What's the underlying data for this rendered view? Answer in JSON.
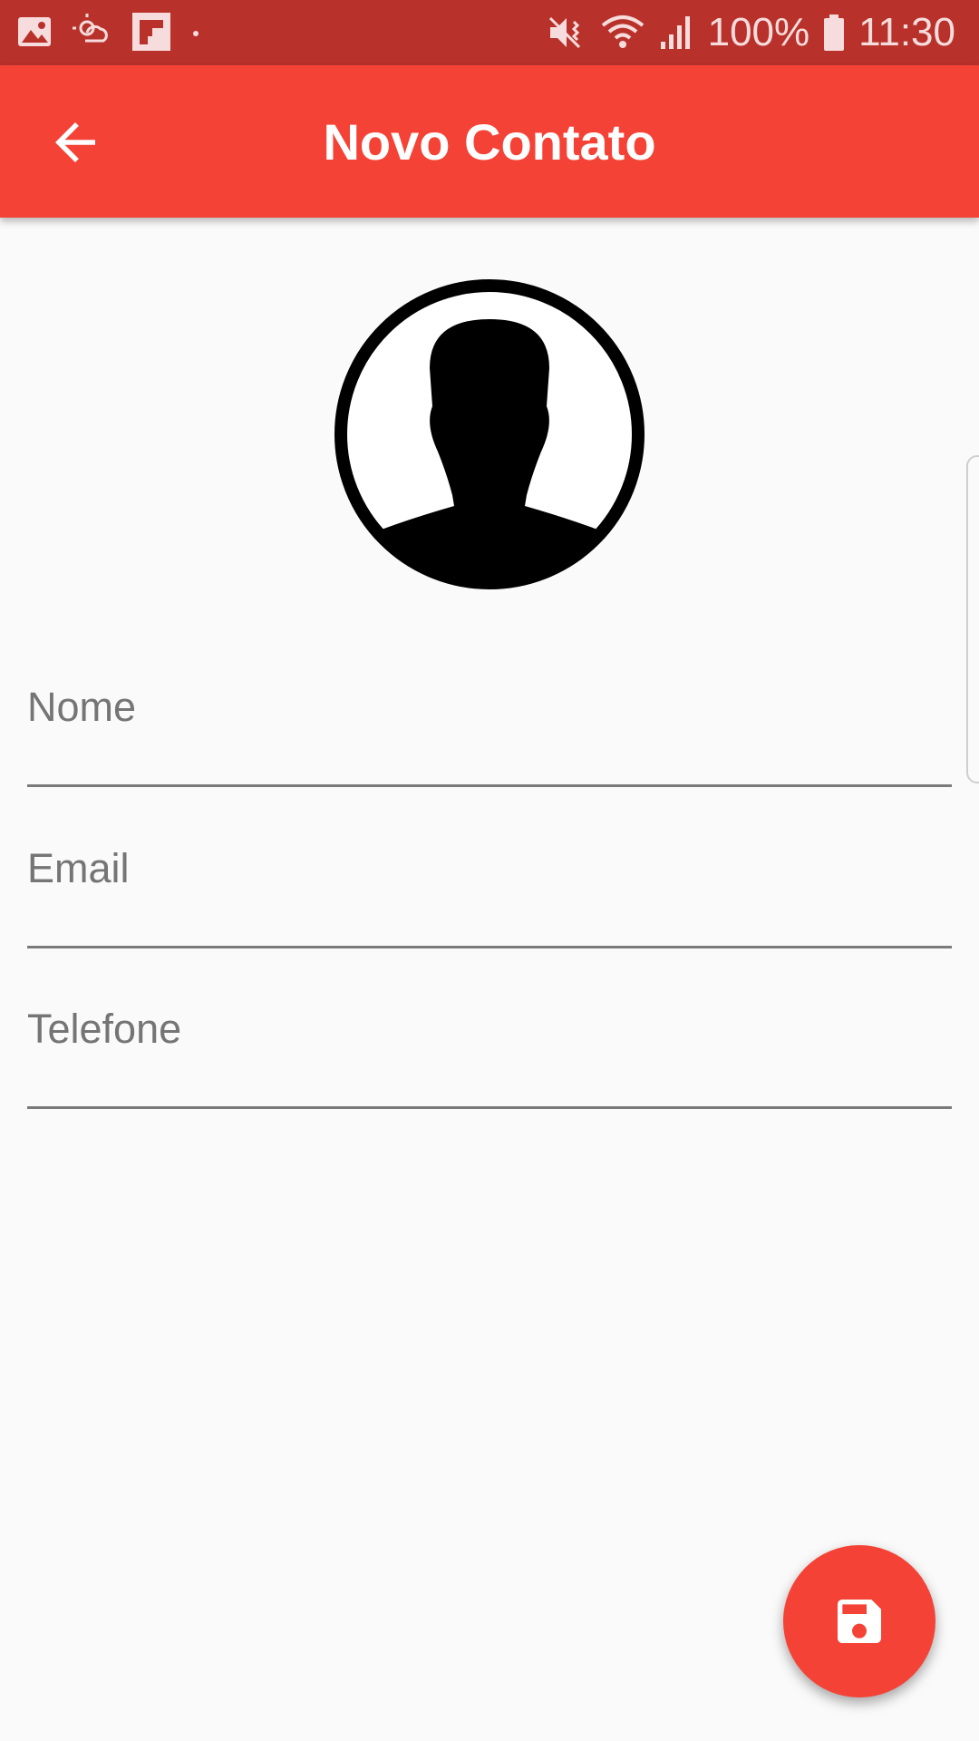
{
  "status_bar": {
    "battery": "100%",
    "time": "11:30",
    "icons": [
      "gallery-icon",
      "weather-icon",
      "flipboard-icon",
      "dot-icon",
      "mute-icon",
      "wifi-icon",
      "signal-icon",
      "battery-icon"
    ]
  },
  "app_bar": {
    "title": "Novo Contato",
    "back_icon": "arrow-back-icon",
    "color": "#f44336",
    "status_color": "#b8322b"
  },
  "avatar": {
    "icon": "person-silhouette-icon"
  },
  "form": {
    "fields": [
      {
        "label": "Nome",
        "value": ""
      },
      {
        "label": "Email",
        "value": ""
      },
      {
        "label": "Telefone",
        "value": ""
      }
    ]
  },
  "fab": {
    "icon": "save-icon",
    "color": "#f44336"
  }
}
